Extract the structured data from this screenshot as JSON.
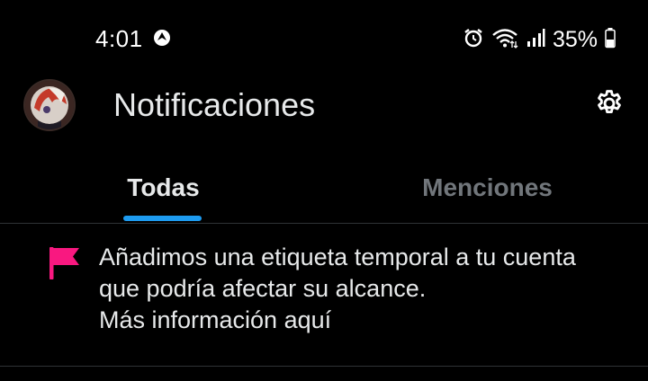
{
  "status_bar": {
    "time": "4:01",
    "app_icon": "compass-icon",
    "icons": [
      "alarm-icon",
      "wifi-icon",
      "signal-icon"
    ],
    "battery": "35%"
  },
  "header": {
    "title": "Notificaciones",
    "avatar_icon": "avatar",
    "settings_icon": "gear-icon"
  },
  "tabs": [
    {
      "label": "Todas",
      "active": true
    },
    {
      "label": "Menciones",
      "active": false
    }
  ],
  "notification": {
    "icon": "flag-icon",
    "text": "Añadimos una etiqueta temporal a tu cuenta que podría afectar su alcance.",
    "link_text": "Más información aquí"
  },
  "colors": {
    "background": "#000000",
    "accent": "#1d9bf0",
    "flag": "#f91880",
    "divider": "#2f3336",
    "muted": "#71767b"
  }
}
